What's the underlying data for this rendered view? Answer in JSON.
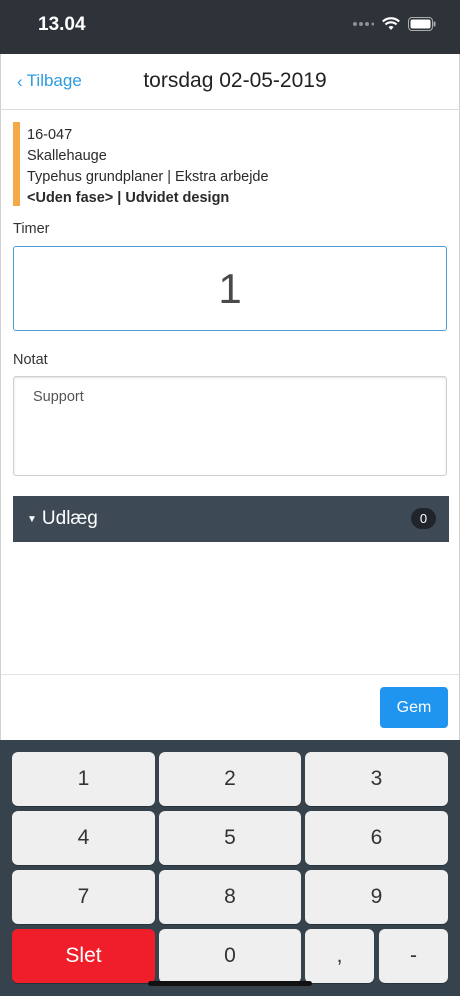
{
  "status_bar": {
    "time": "13.04",
    "icons": [
      "signal-dots-icon",
      "wifi-icon",
      "battery-icon"
    ]
  },
  "nav": {
    "back_label": "Tilbage",
    "title": "torsdag 02-05-2019"
  },
  "task": {
    "number": "16-047",
    "customer": "Skallehauge",
    "project": "Typehus grundplaner | Ekstra arbejde",
    "phase": "<Uden fase> | Udvidet design",
    "accent_color": "#f7a94a"
  },
  "hours": {
    "label": "Timer",
    "value": "1"
  },
  "note": {
    "label": "Notat",
    "value": "Support"
  },
  "expenses": {
    "label": "Udlæg",
    "count": "0"
  },
  "save_label": "Gem",
  "keypad": {
    "keys": [
      "1",
      "2",
      "3",
      "4",
      "5",
      "6",
      "7",
      "8",
      "9",
      "Slet",
      "0",
      ",",
      "-"
    ]
  },
  "colors": {
    "accent_blue": "#1f95ef",
    "delete_red": "#ef1e2a",
    "dark_bar": "#3d4a55"
  }
}
